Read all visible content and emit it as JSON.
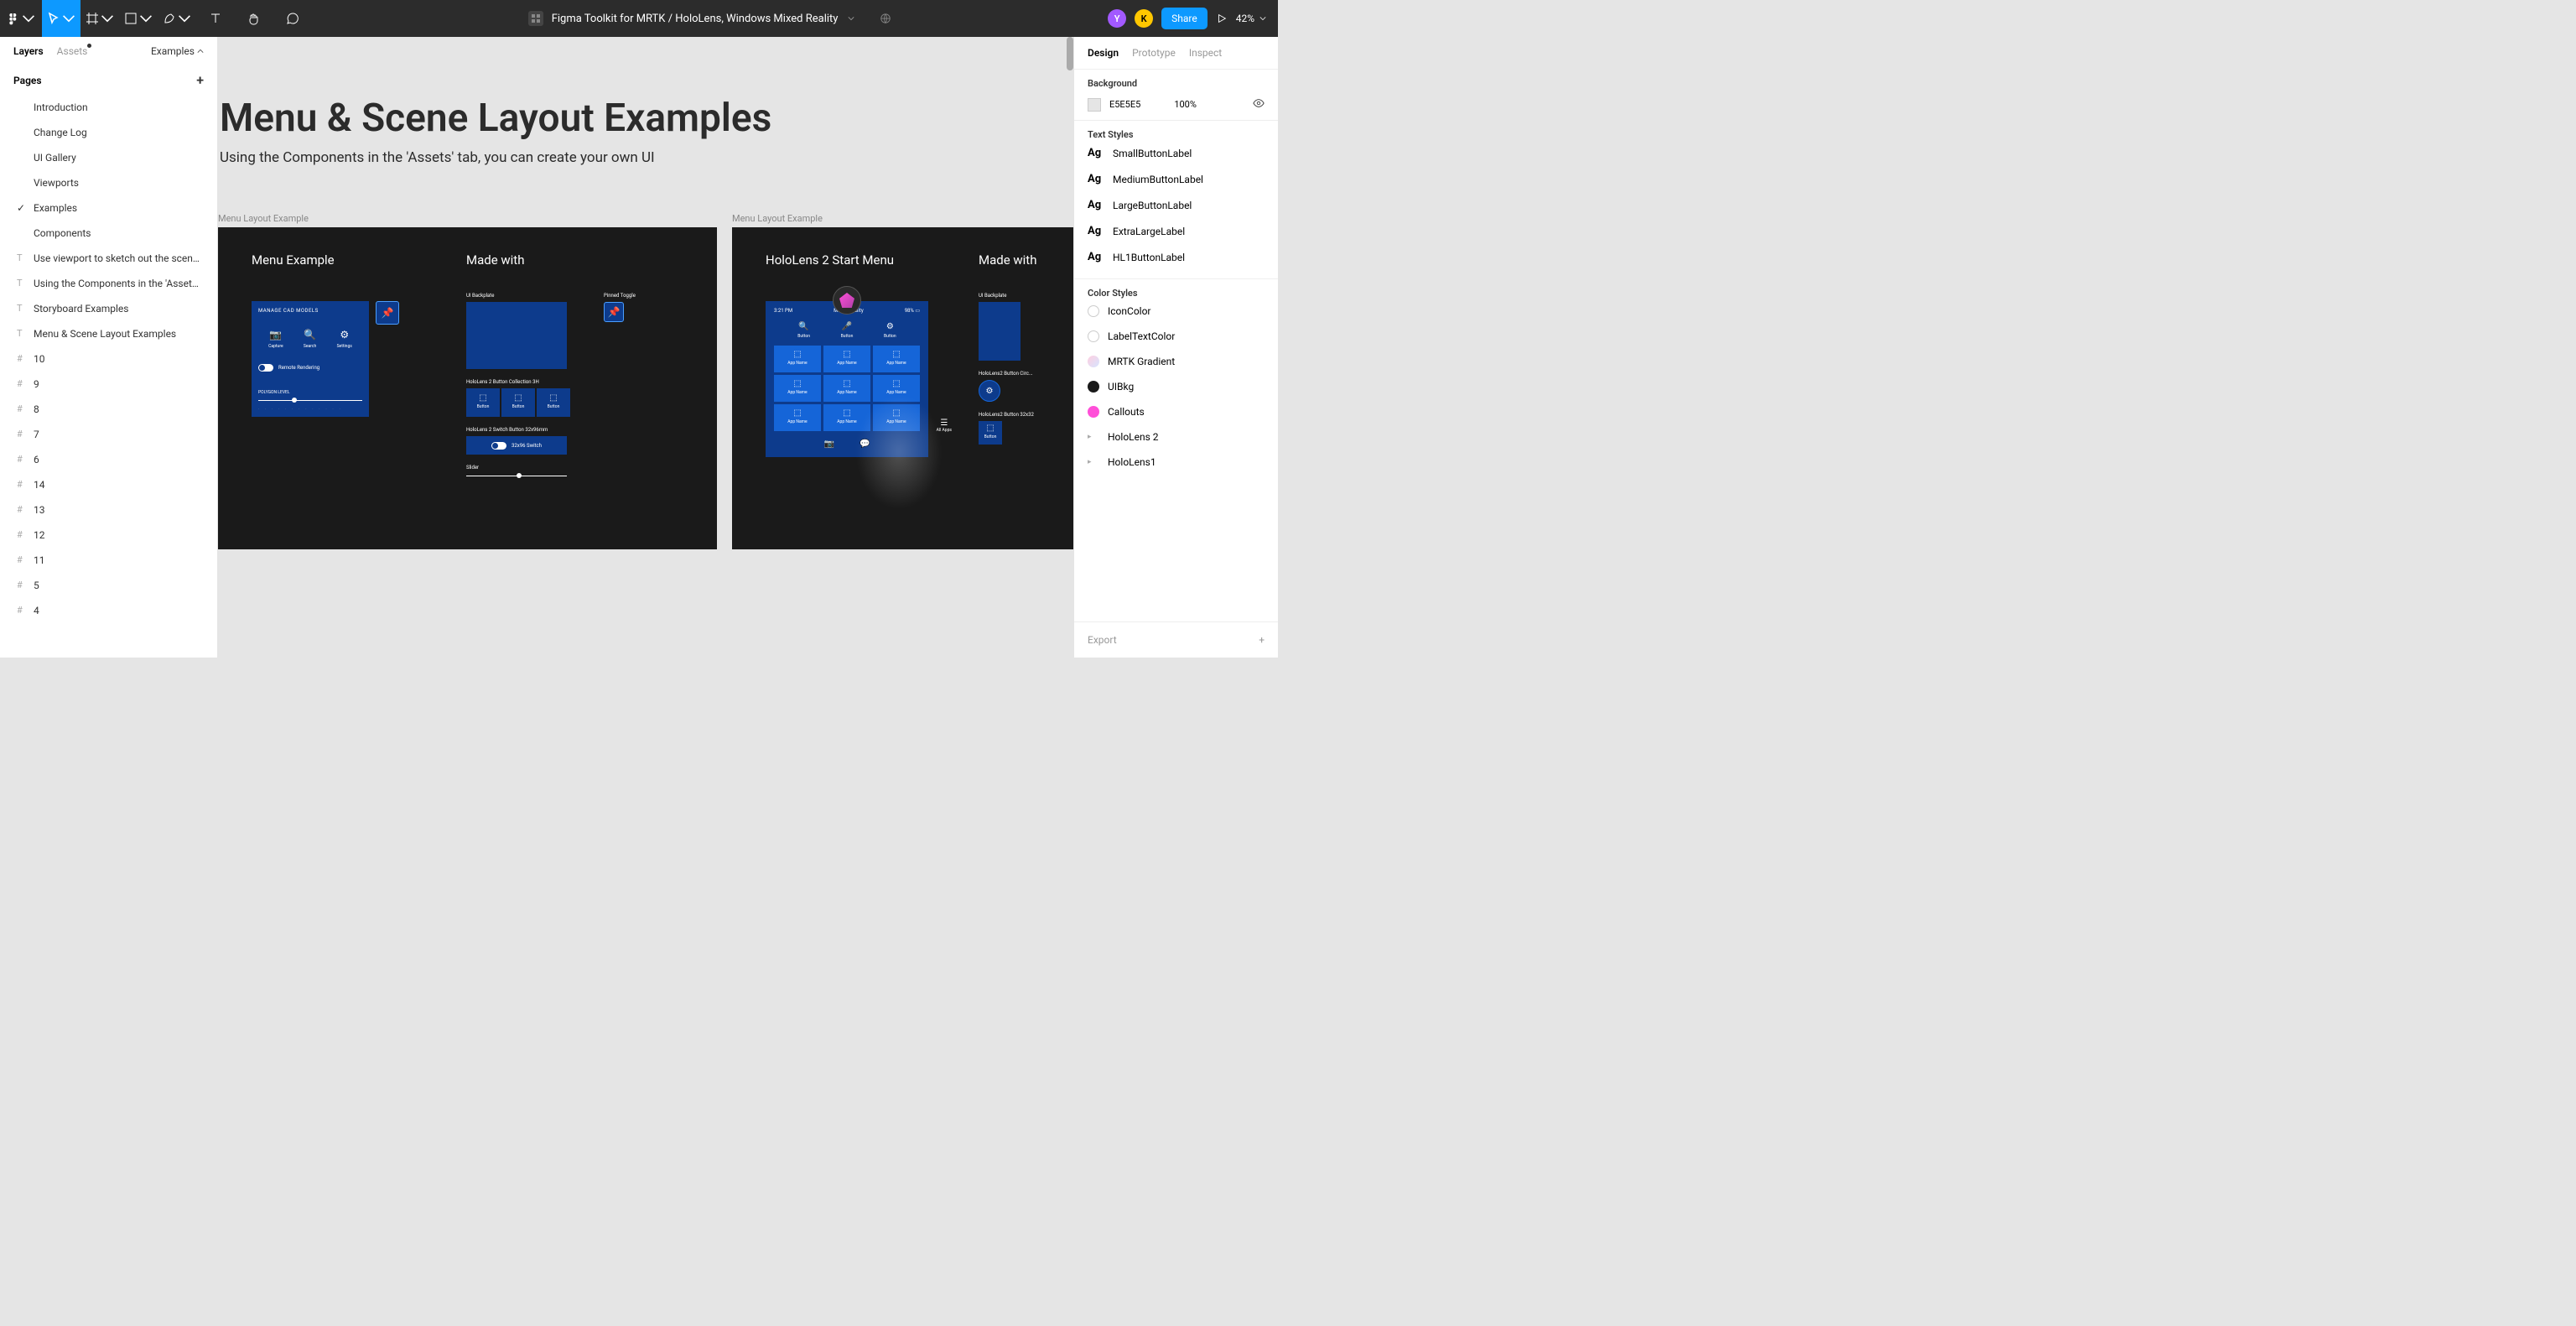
{
  "header": {
    "doc_title": "Figma Toolkit for MRTK / HoloLens, Windows Mixed Reality",
    "share_label": "Share",
    "zoom": "42%",
    "avatars": [
      {
        "letter": "Y",
        "bg": "#a259ff"
      },
      {
        "letter": "K",
        "bg": "#ffc700"
      }
    ]
  },
  "left": {
    "tabs": {
      "layers": "Layers",
      "assets": "Assets"
    },
    "dropdown_label": "Examples",
    "pages_title": "Pages",
    "pages": [
      "Introduction",
      "Change Log",
      "UI Gallery",
      "Viewports",
      "Examples",
      "Components"
    ],
    "active_page_index": 4,
    "layers_text": [
      "Use viewport to sketch out the scene l...",
      "Using the Components in the 'Assets' t...",
      "Storyboard Examples",
      "Menu & Scene Layout Examples"
    ],
    "layers_frame": [
      "10",
      "9",
      "8",
      "7",
      "6",
      "14",
      "13",
      "12",
      "11",
      "5",
      "4"
    ]
  },
  "canvas": {
    "title": "Menu & Scene Layout Examples",
    "subtitle": "Using the Components in the 'Assets' tab, you can create your own UI",
    "frame1": {
      "label": "Menu Layout Example",
      "col1_title": "Menu Example",
      "col2_title": "Made with",
      "card_title": "MANAGE CAD MODELS",
      "icons": [
        {
          "icon": "📷",
          "label": "Capture"
        },
        {
          "icon": "🔍",
          "label": "Search"
        },
        {
          "icon": "⚙",
          "label": "Settings"
        }
      ],
      "toggle_label": "Remote Rendering",
      "poly_label": "POLYGON LEVEL",
      "made_ui_backplate": "UI Backplate",
      "made_pinned": "Pinned Toggle",
      "made_btncoll": "HoloLens 2 Button Collection 3H",
      "btn_label": "Button",
      "made_switch_label": "HoloLens 2 Switch Button 32x96mm",
      "switch_text": "32x96 Switch",
      "made_slider": "Slider"
    },
    "frame2": {
      "label": "Menu Layout Example",
      "col1_title": "HoloLens 2 Start Menu",
      "col2_title": "Made with",
      "time": "3:21 PM",
      "center": "Mixed Reality",
      "battery": "98%",
      "top_icons": [
        {
          "icon": "🔍",
          "label": "Button"
        },
        {
          "icon": "🎤",
          "label": "Button"
        },
        {
          "icon": "⚙",
          "label": "Button"
        }
      ],
      "app_label": "App Name",
      "all_apps": "All Apps",
      "made_ui_backplate": "UI Backplate",
      "made_circ": "HoloLens2 Button Circ...",
      "made_btn32": "HoloLens2 Button 32x32",
      "btn_label": "Button"
    }
  },
  "right": {
    "tabs": {
      "design": "Design",
      "prototype": "Prototype",
      "inspect": "Inspect"
    },
    "bg_title": "Background",
    "bg_hex": "E5E5E5",
    "bg_opacity": "100%",
    "text_styles_title": "Text Styles",
    "text_styles": [
      "SmallButtonLabel",
      "MediumButtonLabel",
      "LargeButtonLabel",
      "ExtraLargeLabel",
      "HL1ButtonLabel"
    ],
    "color_styles_title": "Color Styles",
    "color_styles": [
      {
        "name": "IconColor",
        "color": "#ffffff",
        "border": "#ccc"
      },
      {
        "name": "LabelTextColor",
        "color": "#ffffff",
        "border": "#ccc"
      },
      {
        "name": "MRTK Gradient",
        "color": "linear-gradient(135deg,#ffcfe0,#d6e4ff)",
        "border": "transparent"
      },
      {
        "name": "UIBkg",
        "color": "#1a1a1a",
        "border": "transparent"
      },
      {
        "name": "Callouts",
        "color": "#ff4fd8",
        "border": "transparent"
      }
    ],
    "color_groups": [
      "HoloLens 2",
      "HoloLens1"
    ],
    "export_label": "Export"
  }
}
